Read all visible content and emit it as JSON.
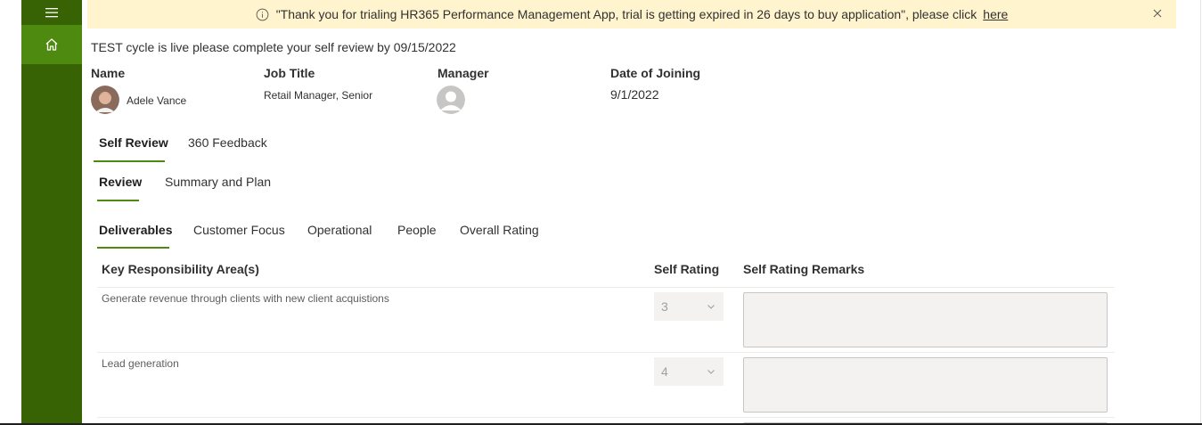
{
  "banner": {
    "message": "\"Thank you for trialing HR365 Performance Management App, trial is getting expired in 26 days to buy application\", please click",
    "link": "here"
  },
  "cycle_notice": "TEST cycle is live please complete your self review by 09/15/2022",
  "profile": {
    "name_label": "Name",
    "name_value": "Adele Vance",
    "job_label": "Job Title",
    "job_value": "Retail Manager, Senior",
    "manager_label": "Manager",
    "doj_label": "Date of Joining",
    "doj_value": "9/1/2022"
  },
  "main_tabs": [
    "Self Review",
    "360 Feedback"
  ],
  "sub_tabs": [
    "Review",
    "Summary and Plan"
  ],
  "section_tabs": [
    "Deliverables",
    "Customer Focus",
    "Operational",
    "People",
    "Overall Rating"
  ],
  "table": {
    "headers": [
      "Key Responsibility Area(s)",
      "Self Rating",
      "Self Rating Remarks"
    ],
    "rows": [
      {
        "kra": "Generate revenue through clients with new client acquistions",
        "rating": "3"
      },
      {
        "kra": "Lead generation",
        "rating": "4"
      }
    ]
  },
  "colors": {
    "rail": "#376305",
    "rail_active": "#4f8a10",
    "banner": "#fff4ce",
    "accent": "#4f8a10"
  },
  "icons": [
    "menu-icon",
    "home-icon",
    "info-icon",
    "close-icon",
    "chevron-down-icon"
  ]
}
